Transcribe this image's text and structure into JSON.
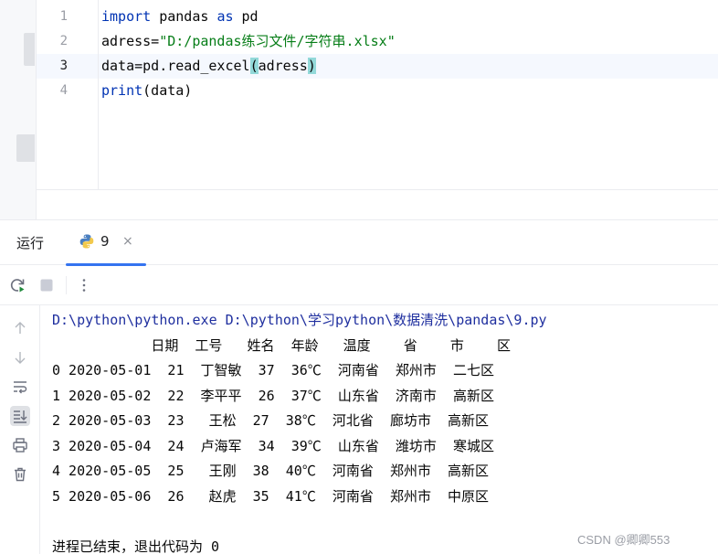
{
  "editor": {
    "line_numbers": [
      "1",
      "2",
      "3",
      "4"
    ],
    "lines": [
      [
        {
          "t": "import",
          "c": "kw"
        },
        {
          "t": " pandas ",
          "c": ""
        },
        {
          "t": "as",
          "c": "kw"
        },
        {
          "t": " pd",
          "c": ""
        }
      ],
      [
        {
          "t": "adress=",
          "c": ""
        },
        {
          "t": "\"D:/pandas练习文件/字符串.xlsx\"",
          "c": "str"
        }
      ],
      [
        {
          "t": "data=pd.read_excel",
          "c": ""
        },
        {
          "t": "(",
          "c": "paren"
        },
        {
          "t": "adress",
          "c": ""
        },
        {
          "t": ")",
          "c": "paren"
        }
      ],
      [
        {
          "t": "print",
          "c": "kw"
        },
        {
          "t": "(data)",
          "c": ""
        }
      ]
    ]
  },
  "run_window": {
    "title": "运行",
    "tab_label": "9",
    "tab_close": "×"
  },
  "console": {
    "command": "D:\\python\\python.exe D:\\python\\学习python\\数据清洗\\pandas\\9.py",
    "table_lines": [
      "            日期  工号   姓名  年龄   温度    省    市    区",
      "0 2020-05-01  21  丁智敏  37  36℃  河南省  郑州市  二七区",
      "1 2020-05-02  22  李平平  26  37℃  山东省  济南市  高新区",
      "2 2020-05-03  23   王松  27  38℃  河北省  廊坊市  高新区",
      "3 2020-05-04  24  卢海军  34  39℃  山东省  潍坊市  寒城区",
      "4 2020-05-05  25   王刚  38  40℃  河南省  郑州市  高新区",
      "5 2020-05-06  26   赵虎  35  41℃  河南省  郑州市  中原区"
    ],
    "exit_message": "进程已结束，退出代码为 0"
  },
  "watermark": "CSDN @卿卿553",
  "colors": {
    "keyword": "#0033b3",
    "string": "#067d17",
    "accent": "#3574f0",
    "bracket_match": "#93d9d9"
  }
}
